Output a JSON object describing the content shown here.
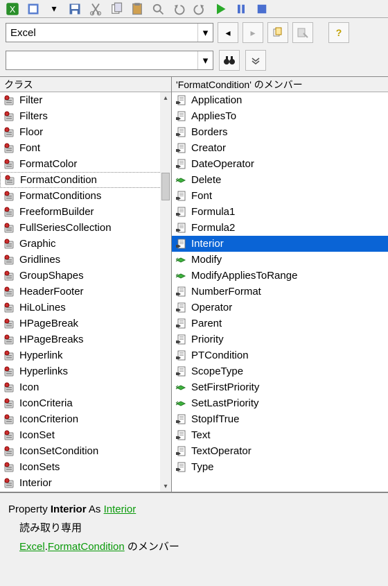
{
  "toolbar": {
    "buttons": [
      "excel-icon",
      "view-icon",
      "dropdown-icon",
      "save-icon",
      "cut-icon",
      "copy-icon",
      "paste-icon",
      "find-icon",
      "undo-icon",
      "redo-icon",
      "run-icon",
      "pause-icon",
      "stop-icon"
    ]
  },
  "library": {
    "selected": "Excel"
  },
  "nav": {
    "back_enabled": true,
    "forward_enabled": false
  },
  "search": {
    "value": ""
  },
  "headers": {
    "classes": "クラス",
    "members_prefix": "'",
    "members_classname": "FormatCondition",
    "members_suffix": "' のメンバー"
  },
  "classes": [
    {
      "name": "Filter",
      "kind": "class"
    },
    {
      "name": "Filters",
      "kind": "class"
    },
    {
      "name": "Floor",
      "kind": "class"
    },
    {
      "name": "Font",
      "kind": "class"
    },
    {
      "name": "FormatColor",
      "kind": "class"
    },
    {
      "name": "FormatCondition",
      "kind": "class",
      "selected": true
    },
    {
      "name": "FormatConditions",
      "kind": "class"
    },
    {
      "name": "FreeformBuilder",
      "kind": "class"
    },
    {
      "name": "FullSeriesCollection",
      "kind": "class"
    },
    {
      "name": "Graphic",
      "kind": "class"
    },
    {
      "name": "Gridlines",
      "kind": "class"
    },
    {
      "name": "GroupShapes",
      "kind": "class"
    },
    {
      "name": "HeaderFooter",
      "kind": "class"
    },
    {
      "name": "HiLoLines",
      "kind": "class"
    },
    {
      "name": "HPageBreak",
      "kind": "class"
    },
    {
      "name": "HPageBreaks",
      "kind": "class"
    },
    {
      "name": "Hyperlink",
      "kind": "class"
    },
    {
      "name": "Hyperlinks",
      "kind": "class"
    },
    {
      "name": "Icon",
      "kind": "class"
    },
    {
      "name": "IconCriteria",
      "kind": "class"
    },
    {
      "name": "IconCriterion",
      "kind": "class"
    },
    {
      "name": "IconSet",
      "kind": "class"
    },
    {
      "name": "IconSetCondition",
      "kind": "class"
    },
    {
      "name": "IconSets",
      "kind": "class"
    },
    {
      "name": "Interior",
      "kind": "class"
    }
  ],
  "members": [
    {
      "name": "Application",
      "kind": "property"
    },
    {
      "name": "AppliesTo",
      "kind": "property"
    },
    {
      "name": "Borders",
      "kind": "property"
    },
    {
      "name": "Creator",
      "kind": "property"
    },
    {
      "name": "DateOperator",
      "kind": "property"
    },
    {
      "name": "Delete",
      "kind": "method"
    },
    {
      "name": "Font",
      "kind": "property"
    },
    {
      "name": "Formula1",
      "kind": "property"
    },
    {
      "name": "Formula2",
      "kind": "property"
    },
    {
      "name": "Interior",
      "kind": "property",
      "selected": true
    },
    {
      "name": "Modify",
      "kind": "method"
    },
    {
      "name": "ModifyAppliesToRange",
      "kind": "method"
    },
    {
      "name": "NumberFormat",
      "kind": "property"
    },
    {
      "name": "Operator",
      "kind": "property"
    },
    {
      "name": "Parent",
      "kind": "property"
    },
    {
      "name": "Priority",
      "kind": "property"
    },
    {
      "name": "PTCondition",
      "kind": "property"
    },
    {
      "name": "ScopeType",
      "kind": "property"
    },
    {
      "name": "SetFirstPriority",
      "kind": "method"
    },
    {
      "name": "SetLastPriority",
      "kind": "method"
    },
    {
      "name": "StopIfTrue",
      "kind": "property"
    },
    {
      "name": "Text",
      "kind": "property"
    },
    {
      "name": "TextOperator",
      "kind": "property"
    },
    {
      "name": "Type",
      "kind": "property"
    }
  ],
  "details": {
    "line1_prefix": "Property ",
    "line1_bold": "Interior",
    "line1_mid": " As ",
    "line1_link": "Interior",
    "line2": "読み取り専用",
    "line3_link1": "Excel",
    "line3_dot": ".",
    "line3_link2": "FormatCondition",
    "line3_suffix": " のメンバー"
  }
}
